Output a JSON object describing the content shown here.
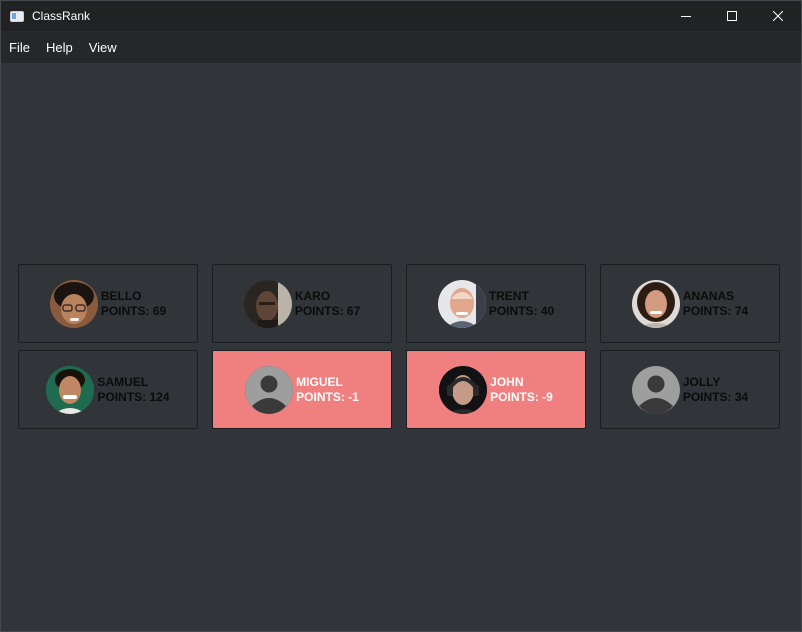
{
  "window": {
    "title": "ClassRank"
  },
  "menu": [
    "File",
    "Help",
    "View"
  ],
  "colors": {
    "positive": "#90ee90",
    "negative": "#f08080",
    "background": "#313438"
  },
  "students": [
    {
      "name": "BELLO",
      "points_label": "POINTS: 69",
      "points": 69,
      "photo": "photo",
      "status": "positive"
    },
    {
      "name": "KARO",
      "points_label": "POINTS: 67",
      "points": 67,
      "photo": "photo",
      "status": "positive"
    },
    {
      "name": "TRENT",
      "points_label": "POINTS: 40",
      "points": 40,
      "photo": "photo",
      "status": "positive"
    },
    {
      "name": "ANANAS",
      "points_label": "POINTS: 74",
      "points": 74,
      "photo": "photo",
      "status": "positive"
    },
    {
      "name": "SAMUEL",
      "points_label": "POINTS: 124",
      "points": 124,
      "photo": "photo",
      "status": "positive"
    },
    {
      "name": "MIGUEL",
      "points_label": "POINTS: -1",
      "points": -1,
      "photo": "default-avatar",
      "status": "negative"
    },
    {
      "name": "JOHN",
      "points_label": "POINTS: -9",
      "points": -9,
      "photo": "photo",
      "status": "negative"
    },
    {
      "name": "JOLLY",
      "points_label": "POINTS: 34",
      "points": 34,
      "photo": "default-avatar",
      "status": "positive"
    }
  ]
}
